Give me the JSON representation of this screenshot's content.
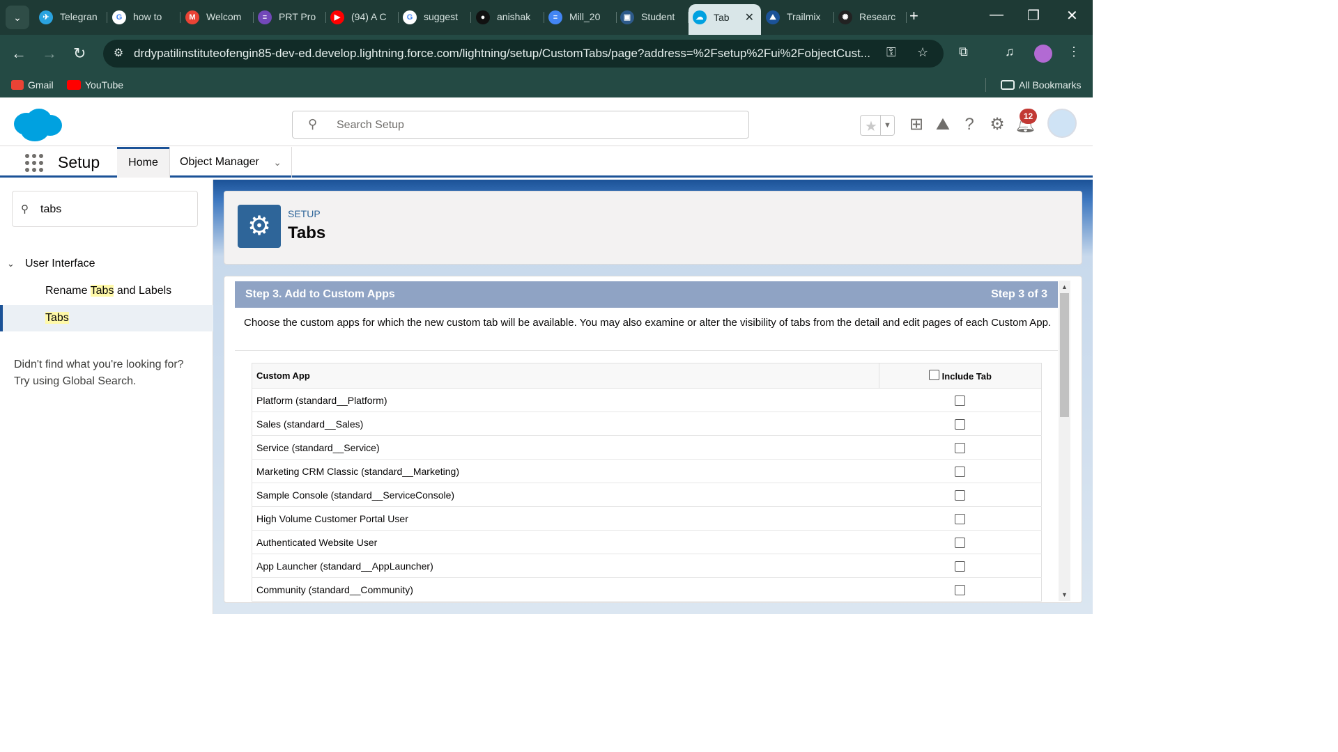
{
  "browser": {
    "tabs": [
      {
        "label": "Telegran",
        "fav": "telegram-icon",
        "color": "#2aa3e0",
        "glyph": "✈"
      },
      {
        "label": "how to",
        "fav": "google-icon",
        "color": "#ffffff",
        "glyph": "G"
      },
      {
        "label": "Welcom",
        "fav": "gmail-icon",
        "color": "#ea4335",
        "glyph": "M"
      },
      {
        "label": "PRT Pro",
        "fav": "forms-icon",
        "color": "#7248b9",
        "glyph": "≡"
      },
      {
        "label": "(94) A C",
        "fav": "youtube-icon",
        "color": "#ff0000",
        "glyph": "▶"
      },
      {
        "label": "suggest",
        "fav": "google-icon",
        "color": "#ffffff",
        "glyph": "G"
      },
      {
        "label": "anishak",
        "fav": "github-icon",
        "color": "#111111",
        "glyph": "●"
      },
      {
        "label": "Mill_20",
        "fav": "docs-icon",
        "color": "#4285f4",
        "glyph": "≡"
      },
      {
        "label": "Student",
        "fav": "dashboard-icon",
        "color": "#2d5a8a",
        "glyph": "▣"
      },
      {
        "label": "Tab",
        "fav": "salesforce-icon",
        "color": "#00a1e0",
        "glyph": "☁"
      },
      {
        "label": "Trailmix",
        "fav": "trailhead-icon",
        "color": "#1b5297",
        "glyph": "⛰"
      },
      {
        "label": "Researc",
        "fav": "openai-icon",
        "color": "#222222",
        "glyph": "✺"
      }
    ],
    "url": "drdypatilinstituteofengin85-dev-ed.develop.lightning.force.com/lightning/setup/CustomTabs/page?address=%2Fsetup%2Fui%2FobjectCust...",
    "bookmarks": {
      "gmail": "Gmail",
      "youtube": "YouTube",
      "all": "All Bookmarks"
    }
  },
  "sf": {
    "search_placeholder": "Search Setup",
    "notif_count": "12",
    "app_name": "Setup",
    "nav": {
      "home": "Home",
      "object_manager": "Object Manager"
    }
  },
  "sidebar": {
    "quickfind_value": "tabs",
    "section": "User Interface",
    "item1_pre": "Rename ",
    "item1_hl": "Tabs",
    "item1_post": " and Labels",
    "item2": "Tabs",
    "notfound_line1": "Didn't find what you're looking for?",
    "notfound_line2": "Try using Global Search."
  },
  "page": {
    "eyebrow": "SETUP",
    "title": "Tabs",
    "step_title": "Step 3. Add to Custom Apps",
    "step_count": "Step 3 of 3",
    "description": "Choose the custom apps for which the new custom tab will be available. You may also examine or alter the visibility of tabs from the detail and edit pages of each Custom App.",
    "table_header": {
      "app": "Custom App",
      "include": "Include Tab"
    },
    "apps": [
      "Platform (standard__Platform)",
      "Sales (standard__Sales)",
      "Service (standard__Service)",
      "Marketing CRM Classic (standard__Marketing)",
      "Sample Console (standard__ServiceConsole)",
      "High Volume Customer Portal User",
      "Authenticated Website User",
      "App Launcher (standard__AppLauncher)",
      "Community (standard__Community)"
    ]
  }
}
